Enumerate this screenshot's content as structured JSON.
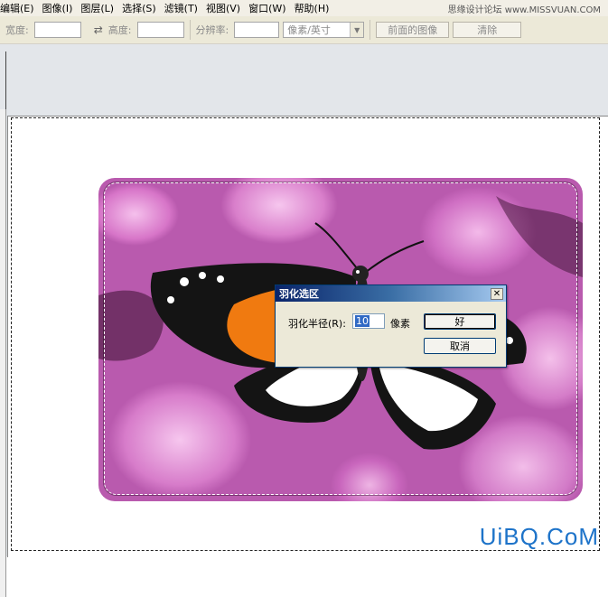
{
  "menubar": {
    "items": [
      "编辑(E)",
      "图像(I)",
      "图层(L)",
      "选择(S)",
      "滤镜(T)",
      "视图(V)",
      "窗口(W)",
      "帮助(H)"
    ]
  },
  "watermark_top": "思缘设计论坛 www.MISSVUAN.COM",
  "options_bar": {
    "width_label": "宽度:",
    "height_label": "高度:",
    "resolution_label": "分辨率:",
    "unit_select": "像素/英寸",
    "front_image_button": "前面的图像",
    "clear_button": "清除"
  },
  "dialog": {
    "title": "羽化选区",
    "radius_label": "羽化半径(R):",
    "radius_value": "10",
    "unit": "像素",
    "ok": "好",
    "cancel": "取消"
  },
  "watermark_bottom": "UiBQ.CoM"
}
